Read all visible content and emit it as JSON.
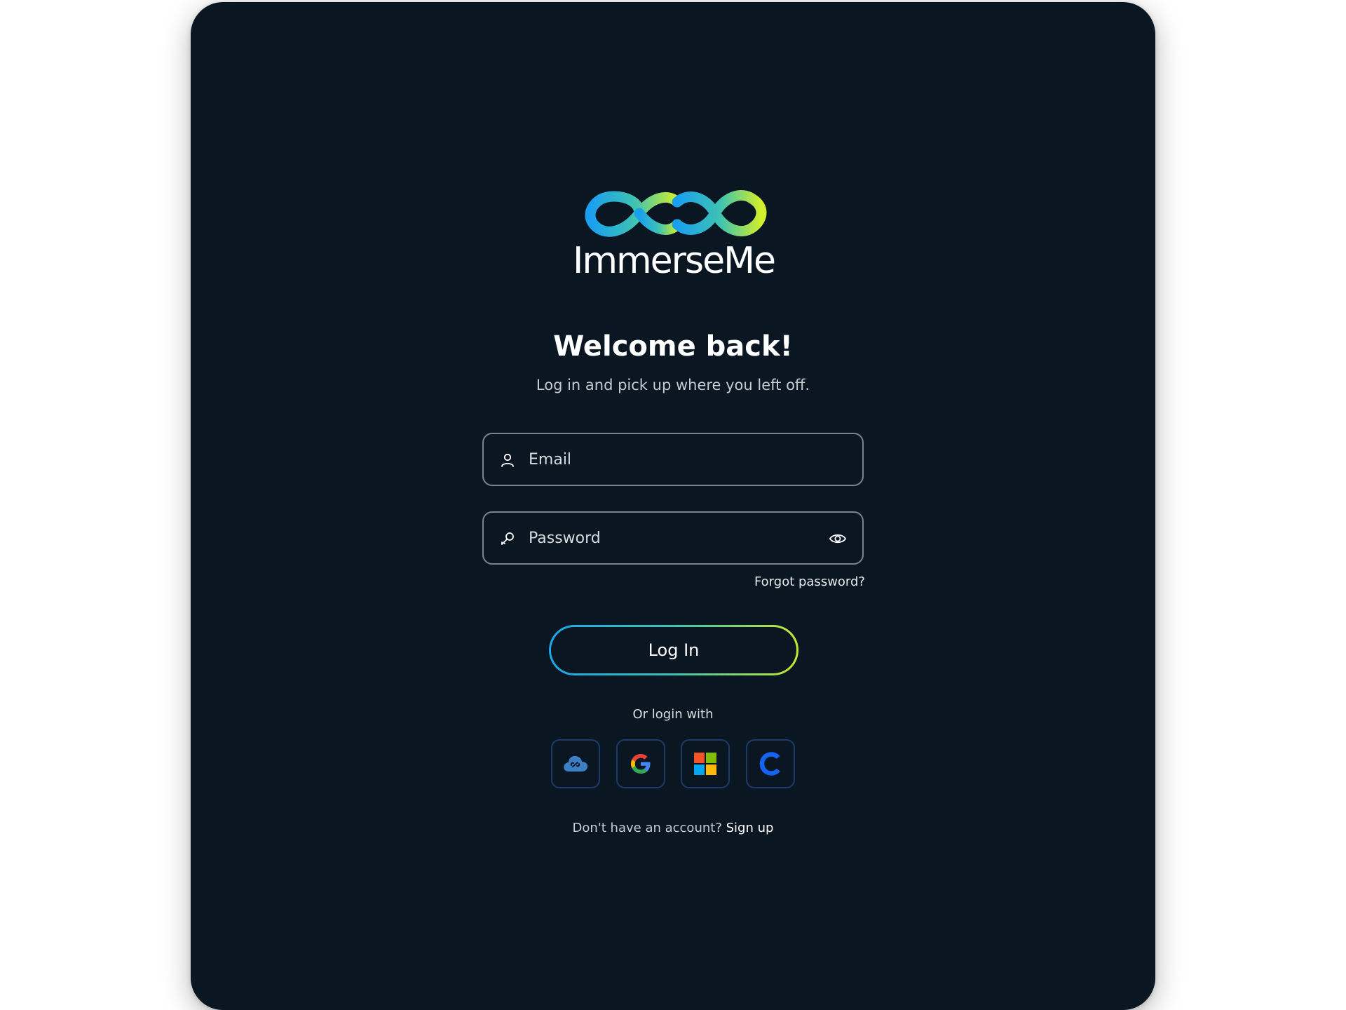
{
  "brand": {
    "name": "ImmerseMe",
    "gradient_start": "#1aa7e8",
    "gradient_mid": "#3cc2b5",
    "gradient_end": "#c5ea2c"
  },
  "card": {
    "background": "#0a1622"
  },
  "heading": {
    "title": "Welcome back!",
    "subtitle": "Log in and pick up where you left off."
  },
  "form": {
    "email": {
      "placeholder": "Email",
      "value": "",
      "icon": "user-icon"
    },
    "password": {
      "placeholder": "Password",
      "value": "",
      "icon": "key-icon",
      "toggle_icon": "eye-icon"
    },
    "forgot_password": "Forgot password?",
    "login_button": "Log In"
  },
  "social": {
    "label": "Or login with",
    "providers": [
      {
        "name": "Cloud",
        "icon": "cloud-link-icon"
      },
      {
        "name": "Google",
        "icon": "google-icon"
      },
      {
        "name": "Microsoft",
        "icon": "microsoft-icon"
      },
      {
        "name": "Clever",
        "icon": "clever-icon"
      }
    ]
  },
  "signup": {
    "prompt": "Don't have an account?",
    "link": "Sign up"
  }
}
